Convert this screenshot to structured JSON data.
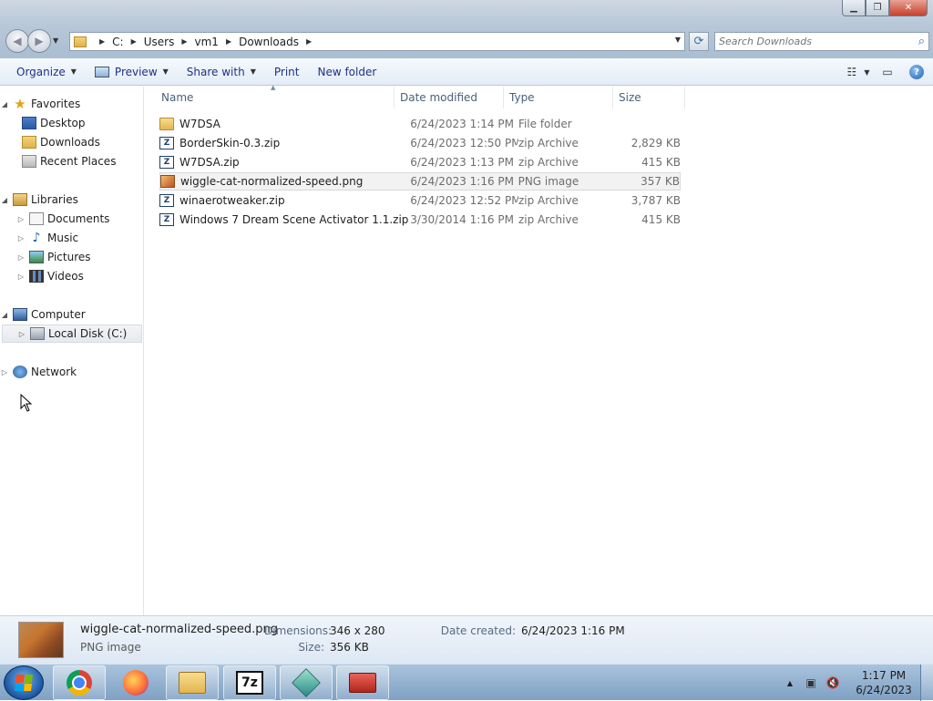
{
  "address": {
    "crumbs": [
      "C:",
      "Users",
      "vm1",
      "Downloads"
    ]
  },
  "search": {
    "placeholder": "Search Downloads"
  },
  "toolbar": {
    "organize": "Organize",
    "preview": "Preview",
    "share_with": "Share with",
    "print": "Print",
    "new_folder": "New folder"
  },
  "nav": {
    "favorites": "Favorites",
    "desktop": "Desktop",
    "downloads": "Downloads",
    "recent_places": "Recent Places",
    "libraries": "Libraries",
    "documents": "Documents",
    "music": "Music",
    "pictures": "Pictures",
    "videos": "Videos",
    "computer": "Computer",
    "local_disk": "Local Disk (C:)",
    "network": "Network"
  },
  "columns": {
    "name": "Name",
    "date": "Date modified",
    "type": "Type",
    "size": "Size"
  },
  "files": [
    {
      "name": "W7DSA",
      "date": "6/24/2023 1:14 PM",
      "type": "File folder",
      "size": "",
      "icon": "folder-icon"
    },
    {
      "name": "BorderSkin-0.3.zip",
      "date": "6/24/2023 12:50 PM",
      "type": "zip Archive",
      "size": "2,829 KB",
      "icon": "zip-icon"
    },
    {
      "name": "W7DSA.zip",
      "date": "6/24/2023 1:13 PM",
      "type": "zip Archive",
      "size": "415 KB",
      "icon": "zip-icon"
    },
    {
      "name": "wiggle-cat-normalized-speed.png",
      "date": "6/24/2023 1:16 PM",
      "type": "PNG image",
      "size": "357 KB",
      "icon": "image-icon"
    },
    {
      "name": "winaerotweaker.zip",
      "date": "6/24/2023 12:52 PM",
      "type": "zip Archive",
      "size": "3,787 KB",
      "icon": "zip-icon"
    },
    {
      "name": "Windows 7 Dream Scene Activator 1.1.zip",
      "date": "3/30/2014 1:16 PM",
      "type": "zip Archive",
      "size": "415 KB",
      "icon": "zip-icon"
    }
  ],
  "details": {
    "file_name": "wiggle-cat-normalized-speed.png",
    "file_kind": "PNG image",
    "dimensions_label": "Dimensions:",
    "dimensions_value": "346 x 280",
    "size_label": "Size:",
    "size_value": "356 KB",
    "date_created_label": "Date created:",
    "date_created_value": "6/24/2023 1:16 PM"
  },
  "taskbar": {
    "time": "1:17 PM",
    "date": "6/24/2023",
    "sevenzip_label": "7z"
  },
  "colors": {
    "link_blue": "#1e3287",
    "accent": "#3a6ea5"
  }
}
